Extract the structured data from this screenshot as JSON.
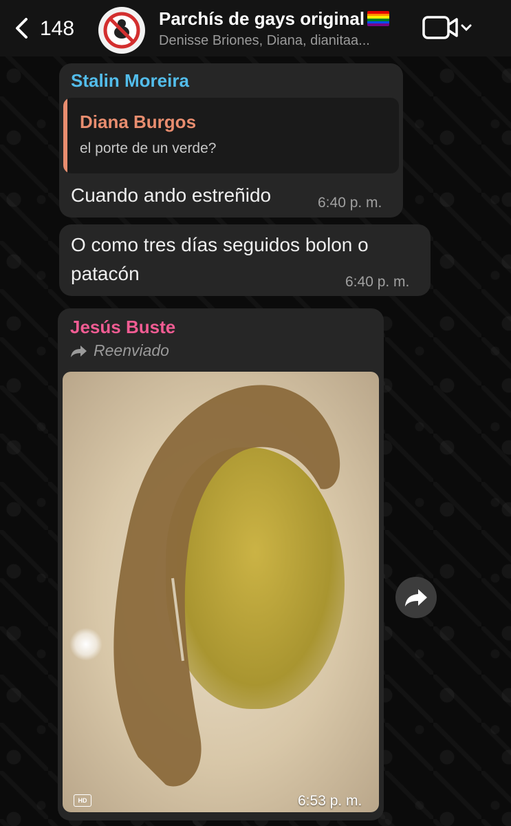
{
  "header": {
    "back_count": "148",
    "title": "Parchís de gays original",
    "subtitle": "Denisse Briones, Diana, dianitaa..."
  },
  "messages": [
    {
      "sender": "Stalin Moreira",
      "sender_color": "#53bdeb",
      "quoted": {
        "author": "Diana Burgos",
        "text": "el porte de un verde?"
      },
      "text": "Cuando ando estreñido",
      "time": "6:40 p. m."
    },
    {
      "text_line1": "O como tres días seguidos bolon o",
      "text_line2": "patacón",
      "time": "6:40 p. m."
    },
    {
      "sender": "Jesús Buste",
      "sender_color": "#f15c93",
      "forwarded_label": "Reenviado",
      "media_badge": "HD",
      "time": "6:53 p. m."
    }
  ],
  "icons": [
    "chevron-left-icon",
    "no-entry-icon",
    "rainbow-flag-icon",
    "video-camera-icon",
    "chevron-down-icon",
    "forward-arrow-icon",
    "share-icon"
  ]
}
